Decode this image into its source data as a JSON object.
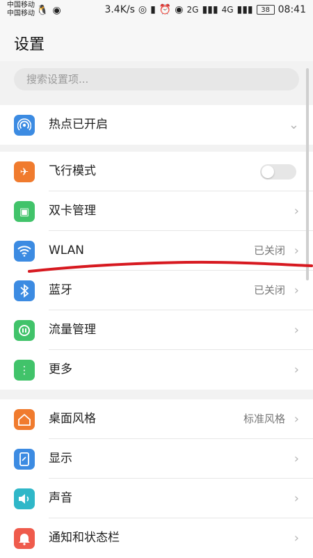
{
  "status_bar": {
    "carrier1": "中国移动",
    "carrier2": "中国移动",
    "speed": "3.4K/s",
    "network1": "2G",
    "network2": "4G",
    "battery": "38",
    "time": "08:41"
  },
  "header": {
    "title": "设置"
  },
  "search": {
    "placeholder": "搜索设置项..."
  },
  "groups": [
    {
      "items": [
        {
          "label": "热点已开启",
          "icon": "hotspot-icon",
          "color": "#3c8be2"
        }
      ]
    },
    {
      "items": [
        {
          "label": "飞行模式",
          "icon": "airplane-icon",
          "color": "#f07b2e",
          "toggle": "off"
        },
        {
          "label": "双卡管理",
          "icon": "sim-card-icon",
          "color": "#41c36a"
        },
        {
          "label": "WLAN",
          "value": "已关闭",
          "icon": "wifi-icon",
          "color": "#3c8be2"
        },
        {
          "label": "蓝牙",
          "value": "已关闭",
          "icon": "bluetooth-icon",
          "color": "#3c8be2"
        },
        {
          "label": "流量管理",
          "icon": "data-usage-icon",
          "color": "#41c36a"
        },
        {
          "label": "更多",
          "icon": "more-icon",
          "color": "#41c36a"
        }
      ]
    },
    {
      "items": [
        {
          "label": "桌面风格",
          "value": "标准风格",
          "icon": "home-icon",
          "color": "#f07b2e"
        },
        {
          "label": "显示",
          "icon": "display-icon",
          "color": "#3c8be2"
        },
        {
          "label": "声音",
          "icon": "sound-icon",
          "color": "#2fb7c8"
        },
        {
          "label": "通知和状态栏",
          "icon": "notification-icon",
          "color": "#ef5b4c"
        }
      ]
    }
  ],
  "annotation_color": "#d71920"
}
